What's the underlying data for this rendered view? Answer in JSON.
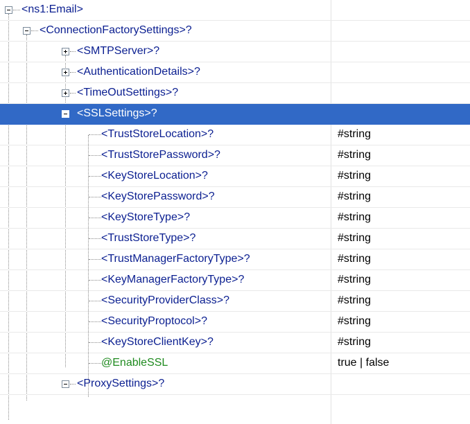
{
  "tree": {
    "root": {
      "label": "<ns1:Email>"
    },
    "connection_factory": {
      "label": "<ConnectionFactorySettings>?"
    },
    "smtp_server": {
      "label": "<SMTPServer>?"
    },
    "authentication_details": {
      "label": "<AuthenticationDetails>?"
    },
    "timeout_settings": {
      "label": "<TimeOutSettings>?"
    },
    "ssl_settings": {
      "label": "<SSLSettings>?"
    },
    "ssl_children": [
      {
        "label": "<TrustStoreLocation>?",
        "value": "#string"
      },
      {
        "label": "<TrustStorePassword>?",
        "value": "#string"
      },
      {
        "label": "<KeyStoreLocation>?",
        "value": "#string"
      },
      {
        "label": "<KeyStorePassword>?",
        "value": "#string"
      },
      {
        "label": "<KeyStoreType>?",
        "value": "#string"
      },
      {
        "label": "<TrustStoreType>?",
        "value": "#string"
      },
      {
        "label": "<TrustManagerFactoryType>?",
        "value": "#string"
      },
      {
        "label": "<KeyManagerFactoryType>?",
        "value": "#string"
      },
      {
        "label": "<SecurityProviderClass>?",
        "value": "#string"
      },
      {
        "label": "<SecurityProptocol>?",
        "value": "#string"
      },
      {
        "label": "<KeyStoreClientKey>?",
        "value": "#string"
      }
    ],
    "enable_ssl": {
      "label": "@EnableSSL",
      "value": "true | false"
    },
    "proxy_settings": {
      "label": "<ProxySettings>?"
    }
  },
  "colors": {
    "element_text": "#0a1e90",
    "attribute_text": "#1e8a1e",
    "selection": "#3169c6"
  }
}
